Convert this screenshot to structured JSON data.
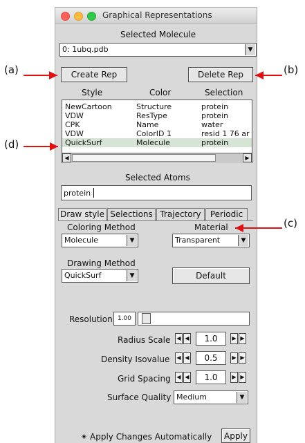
{
  "window": {
    "title": "Graphical Representations",
    "selected_molecule_label": "Selected Molecule",
    "selected_molecule_value": "0: 1ubq.pdb",
    "create_rep_label": "Create Rep",
    "delete_rep_label": "Delete Rep"
  },
  "reps_table": {
    "headers": [
      "Style",
      "Color",
      "Selection"
    ],
    "rows": [
      {
        "style": "NewCartoon",
        "color": "Structure",
        "selection": "protein"
      },
      {
        "style": "VDW",
        "color": "ResType",
        "selection": "protein"
      },
      {
        "style": "CPK",
        "color": "Name",
        "selection": "water"
      },
      {
        "style": "VDW",
        "color": "ColorID 1",
        "selection": "resid 1 76 ar"
      },
      {
        "style": "QuickSurf",
        "color": "Molecule",
        "selection": "protein"
      }
    ],
    "selected_row": 4
  },
  "selected_atoms": {
    "label": "Selected Atoms",
    "value": "protein"
  },
  "tabs": [
    "Draw style",
    "Selections",
    "Trajectory",
    "Periodic"
  ],
  "draw_style": {
    "coloring_method_label": "Coloring Method",
    "coloring_method_value": "Molecule",
    "material_label": "Material",
    "material_value": "Transparent",
    "drawing_method_label": "Drawing Method",
    "drawing_method_value": "QuickSurf",
    "default_label": "Default",
    "resolution_label": "Resolution",
    "resolution_value": "1.00",
    "resolution_fraction": 0.03,
    "radius_scale_label": "Radius Scale",
    "radius_scale_value": "1.0",
    "density_isovalue_label": "Density Isovalue",
    "density_isovalue_value": "0.5",
    "grid_spacing_label": "Grid Spacing",
    "grid_spacing_value": "1.0",
    "surface_quality_label": "Surface Quality",
    "surface_quality_value": "Medium"
  },
  "footer": {
    "apply_auto_label": "Apply Changes Automatically",
    "apply_label": "Apply"
  },
  "annotations": {
    "a": "(a)",
    "b": "(b)",
    "c": "(c)",
    "d": "(d)",
    "arrow_color": "#dd1111"
  }
}
